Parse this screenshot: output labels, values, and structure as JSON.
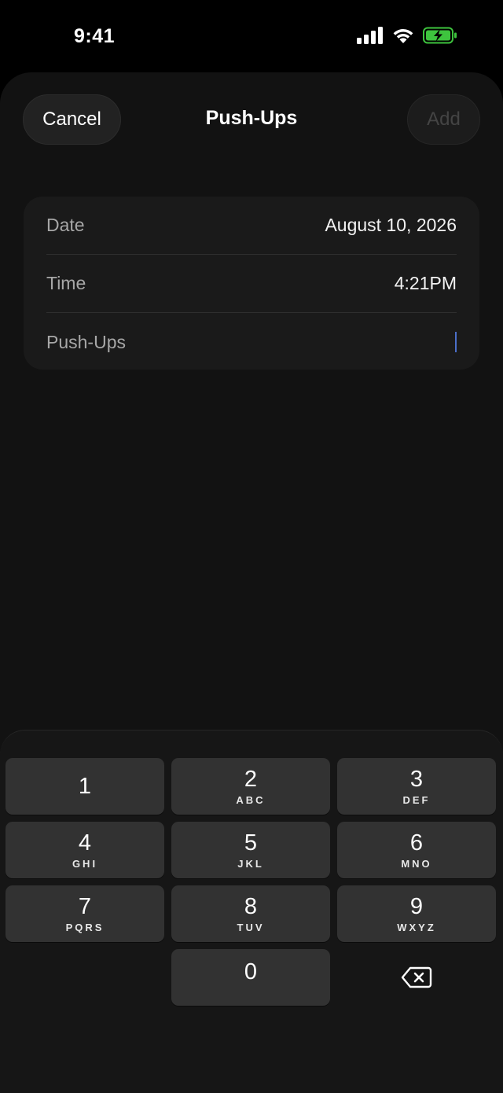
{
  "status_bar": {
    "time": "9:41",
    "icons": [
      "cellular-signal-icon",
      "wifi-icon",
      "battery-charging-icon"
    ],
    "battery_color": "#3ec43e"
  },
  "sheet": {
    "cancel_label": "Cancel",
    "title": "Push-Ups",
    "add_label": "Add"
  },
  "form": {
    "rows": [
      {
        "label": "Date",
        "value": "August 10, 2026"
      },
      {
        "label": "Time",
        "value": "4:21PM"
      },
      {
        "label": "Push-Ups",
        "value": ""
      }
    ]
  },
  "keypad": {
    "keys": [
      {
        "num": "1",
        "letters": ""
      },
      {
        "num": "2",
        "letters": "ABC"
      },
      {
        "num": "3",
        "letters": "DEF"
      },
      {
        "num": "4",
        "letters": "GHI"
      },
      {
        "num": "5",
        "letters": "JKL"
      },
      {
        "num": "6",
        "letters": "MNO"
      },
      {
        "num": "7",
        "letters": "PQRS"
      },
      {
        "num": "8",
        "letters": "TUV"
      },
      {
        "num": "9",
        "letters": "WXYZ"
      },
      {
        "num": "0",
        "letters": ""
      }
    ],
    "delete_icon": "delete-backspace-icon"
  }
}
